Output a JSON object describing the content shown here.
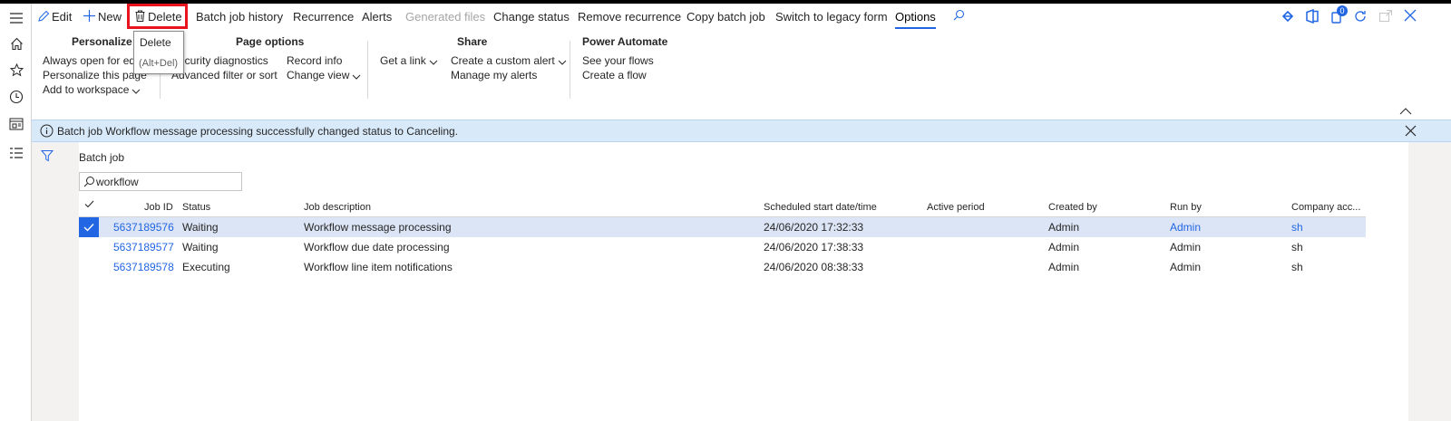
{
  "action_pane": {
    "edit": "Edit",
    "new": "New",
    "delete": "Delete",
    "batch_job_history": "Batch job history",
    "recurrence": "Recurrence",
    "alerts": "Alerts",
    "generated_files": "Generated files",
    "change_status": "Change status",
    "remove_recurrence": "Remove recurrence",
    "copy_batch_job": "Copy batch job",
    "switch_legacy": "Switch to legacy form",
    "options": "Options",
    "notification_count": "0"
  },
  "tooltip": {
    "title": "Delete",
    "shortcut": "(Alt+Del)"
  },
  "ribbon": {
    "personalize": {
      "title": "Personalize",
      "items": [
        "Always open for editing",
        "Personalize this page",
        "Add to workspace"
      ]
    },
    "page_options": {
      "title": "Page options",
      "items": [
        "Security diagnostics",
        "Advanced filter or sort",
        "Record info",
        "Change view"
      ]
    },
    "share": {
      "title": "Share",
      "items": [
        "Get a link",
        "Create a custom alert",
        "Manage my alerts"
      ]
    },
    "power_automate": {
      "title": "Power Automate",
      "items": [
        "See your flows",
        "Create a flow"
      ]
    }
  },
  "message": {
    "text": "Batch job Workflow message processing successfully changed status to Canceling."
  },
  "page": {
    "title": "Batch job",
    "search_value": "workflow"
  },
  "grid": {
    "columns": [
      "Job ID",
      "Status",
      "Job description",
      "Scheduled start date/time",
      "Active period",
      "Created by",
      "Run by",
      "Company acc..."
    ],
    "rows": [
      {
        "job_id": "5637189576",
        "status": "Waiting",
        "description": "Workflow message processing",
        "scheduled": "24/06/2020 17:32:33",
        "active_period": "",
        "created_by": "Admin",
        "run_by": "Admin",
        "company": "sh"
      },
      {
        "job_id": "5637189577",
        "status": "Waiting",
        "description": "Workflow due date processing",
        "scheduled": "24/06/2020 17:38:33",
        "active_period": "",
        "created_by": "Admin",
        "run_by": "Admin",
        "company": "sh"
      },
      {
        "job_id": "5637189578",
        "status": "Executing",
        "description": "Workflow line item notifications",
        "scheduled": "24/06/2020 08:38:33",
        "active_period": "",
        "created_by": "Admin",
        "run_by": "Admin",
        "company": "sh"
      }
    ]
  },
  "colors": {
    "accent": "#2266e3",
    "highlight": "#e8141d",
    "message_bg": "#d8eafa",
    "selected_row": "#dce5f5"
  },
  "icons": {
    "nav": [
      "hamburger-icon",
      "home-icon",
      "star-icon",
      "clock-icon",
      "workspace-icon",
      "list-icon"
    ],
    "right": [
      "diamond-icon",
      "office-icon",
      "notification-icon",
      "refresh-icon",
      "popout-icon",
      "close-icon"
    ]
  }
}
